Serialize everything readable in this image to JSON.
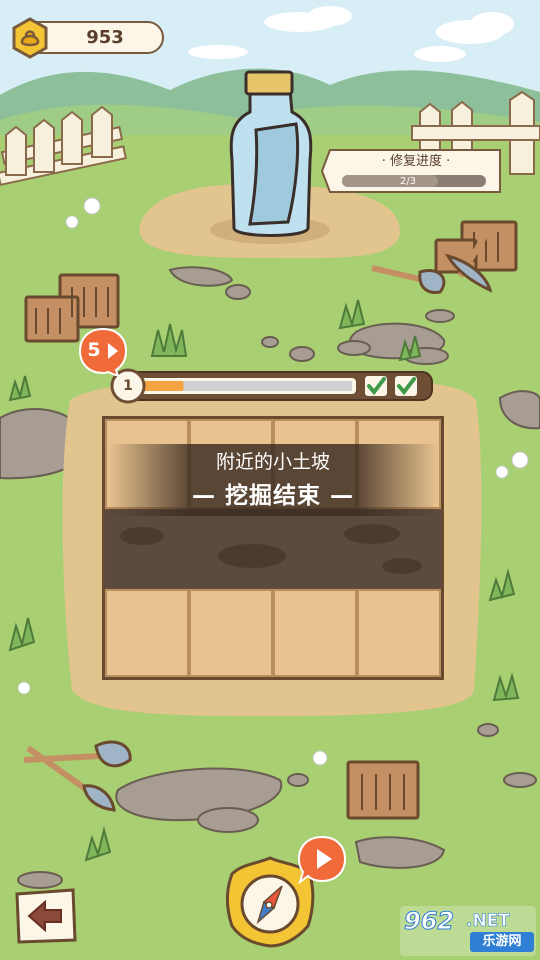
{
  "hud": {
    "coin_count": "953",
    "coin_icon": "gold-coin-icon"
  },
  "repair_progress": {
    "title": "· 修复进度 ·",
    "value_text": "2/3",
    "fraction": 0.667
  },
  "dig": {
    "level": "1",
    "progress_fraction": 0.19,
    "checks": [
      "check-icon",
      "check-icon"
    ],
    "timer": "5",
    "location": "附近的小土坡",
    "status": "— 挖掘结束 —"
  },
  "buttons": {
    "back_icon": "back-arrow-icon",
    "compass_icon": "compass-icon",
    "video_icon": "play-icon"
  },
  "watermark": {
    "number": "962",
    "suffix": ".NET",
    "subtitle": "乐游网"
  },
  "colors": {
    "grass": "#a8cf72",
    "dirt": "#e2c48f",
    "dark_soil": "#5d4a3e",
    "accent_orange": "#f06a3a",
    "progress_orange": "#f5a340",
    "outline": "#6a4a2e"
  }
}
